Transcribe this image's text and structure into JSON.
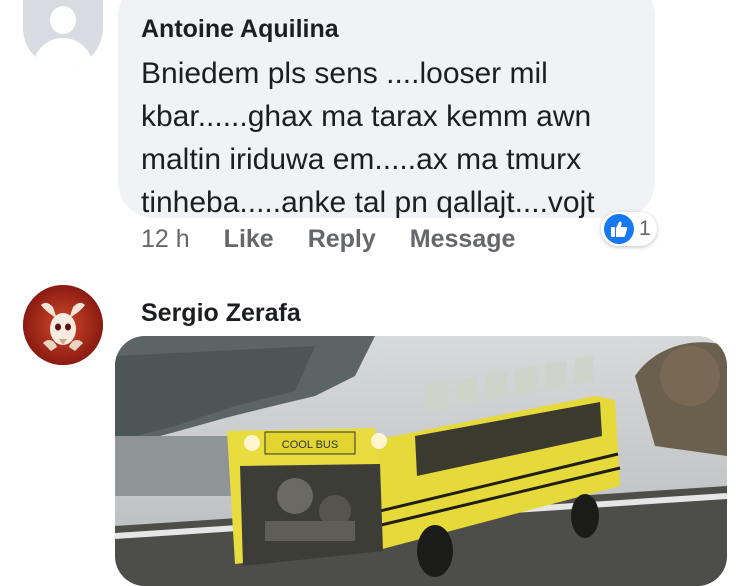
{
  "comments": [
    {
      "author": "Antoine Aquilina",
      "text_lines": [
        "Bniedem pls sens ....looser mil",
        "kbar......ghax ma tarax kemm awn",
        "maltin iriduwa em.....ax ma tmurx",
        "tinheba.....anke tal pn qallajt....vojt"
      ],
      "time": "12 h",
      "actions": [
        "Like",
        "Reply",
        "Message"
      ],
      "reaction_count": "1",
      "reaction_icon": "like-icon",
      "avatar": "default-avatar-icon"
    },
    {
      "author": "Sergio Zerafa",
      "avatar": "profile-photo",
      "attachment": {
        "type": "image",
        "sign_text": "COOL BUS"
      }
    }
  ],
  "colors": {
    "bubble": "#f0f2f5",
    "link_gray": "#65676b",
    "text": "#1c1e21",
    "like_blue": "#1877f2"
  }
}
